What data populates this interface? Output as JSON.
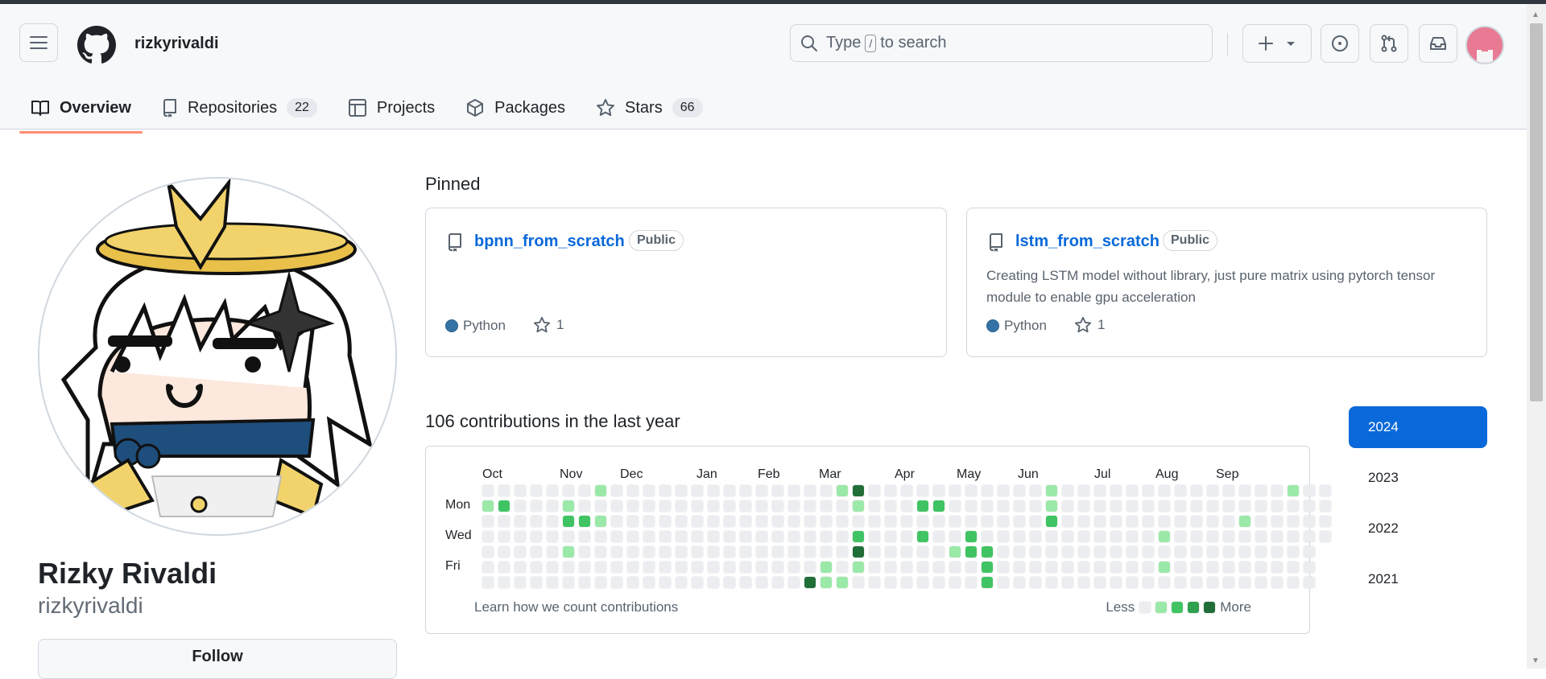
{
  "header": {
    "username": "rizkyrivaldi",
    "search_prefix": "Type",
    "search_slash": "/",
    "search_suffix": "to search"
  },
  "tabs": [
    {
      "label": "Overview",
      "icon": "book-icon"
    },
    {
      "label": "Repositories",
      "icon": "repo-icon",
      "count": "22"
    },
    {
      "label": "Projects",
      "icon": "table-icon"
    },
    {
      "label": "Packages",
      "icon": "package-icon"
    },
    {
      "label": "Stars",
      "icon": "star-icon",
      "count": "66"
    }
  ],
  "profile": {
    "fullname": "Rizky Rivaldi",
    "login": "rizkyrivaldi",
    "follow_label": "Follow"
  },
  "pinned": {
    "title": "Pinned",
    "repos": [
      {
        "name": "bpnn_from_scratch",
        "visibility": "Public",
        "description": "",
        "language": "Python",
        "language_color": "#3572a5",
        "stars": "1"
      },
      {
        "name": "lstm_from_scratch",
        "visibility": "Public",
        "description": "Creating LSTM model without library, just pure matrix using pytorch tensor module to enable gpu acceleration",
        "language": "Python",
        "language_color": "#3572a5",
        "stars": "1"
      }
    ]
  },
  "contributions": {
    "title": "106 contributions in the last year",
    "months": [
      "Oct",
      "Nov",
      "Dec",
      "Jan",
      "Feb",
      "Mar",
      "Apr",
      "May",
      "Jun",
      "Jul",
      "Aug",
      "Sep"
    ],
    "day_labels": [
      "Mon",
      "Wed",
      "Fri"
    ],
    "learn_link": "Learn how we count contributions",
    "legend_less": "Less",
    "legend_more": "More",
    "colors": [
      "#ebedf0",
      "#9be9a8",
      "#40c463",
      "#30a14e",
      "#216e39"
    ]
  },
  "years": [
    "2024",
    "2023",
    "2022",
    "2021"
  ]
}
